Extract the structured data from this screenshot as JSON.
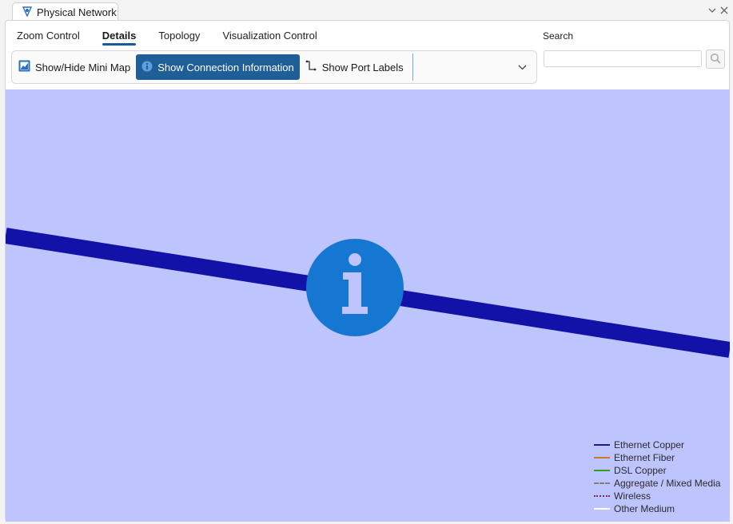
{
  "window": {
    "tab_title": "Physical Network",
    "minimize_icon": "chevron-down-icon",
    "close_icon": "close-icon"
  },
  "ribbon": {
    "tabs": [
      {
        "label": "Zoom Control",
        "active": false
      },
      {
        "label": "Details",
        "active": true
      },
      {
        "label": "Topology",
        "active": false
      },
      {
        "label": "Visualization Control",
        "active": false
      }
    ]
  },
  "toolbar": {
    "minimap_label": "Show/Hide Mini Map",
    "connection_info_label": "Show Connection Information",
    "port_labels_label": "Show Port Labels",
    "dropdown_value": ""
  },
  "search": {
    "label": "Search",
    "value": "",
    "placeholder": ""
  },
  "canvas": {
    "background_color": "#bec5fe",
    "link_color": "#1212a8",
    "info_marker_color": "#1677d2"
  },
  "legend": {
    "items": [
      {
        "label": "Ethernet Copper",
        "color": "#1a1a8a",
        "style": "solid"
      },
      {
        "label": "Ethernet Fiber",
        "color": "#c87a3a",
        "style": "solid"
      },
      {
        "label": "DSL Copper",
        "color": "#2aa02a",
        "style": "solid"
      },
      {
        "label": "Aggregate / Mixed Media",
        "color": "#808080",
        "style": "dashed"
      },
      {
        "label": "Wireless",
        "color": "#8a1a8a",
        "style": "dotted"
      },
      {
        "label": "Other Medium",
        "color": "#ffffff",
        "style": "solid"
      }
    ]
  }
}
